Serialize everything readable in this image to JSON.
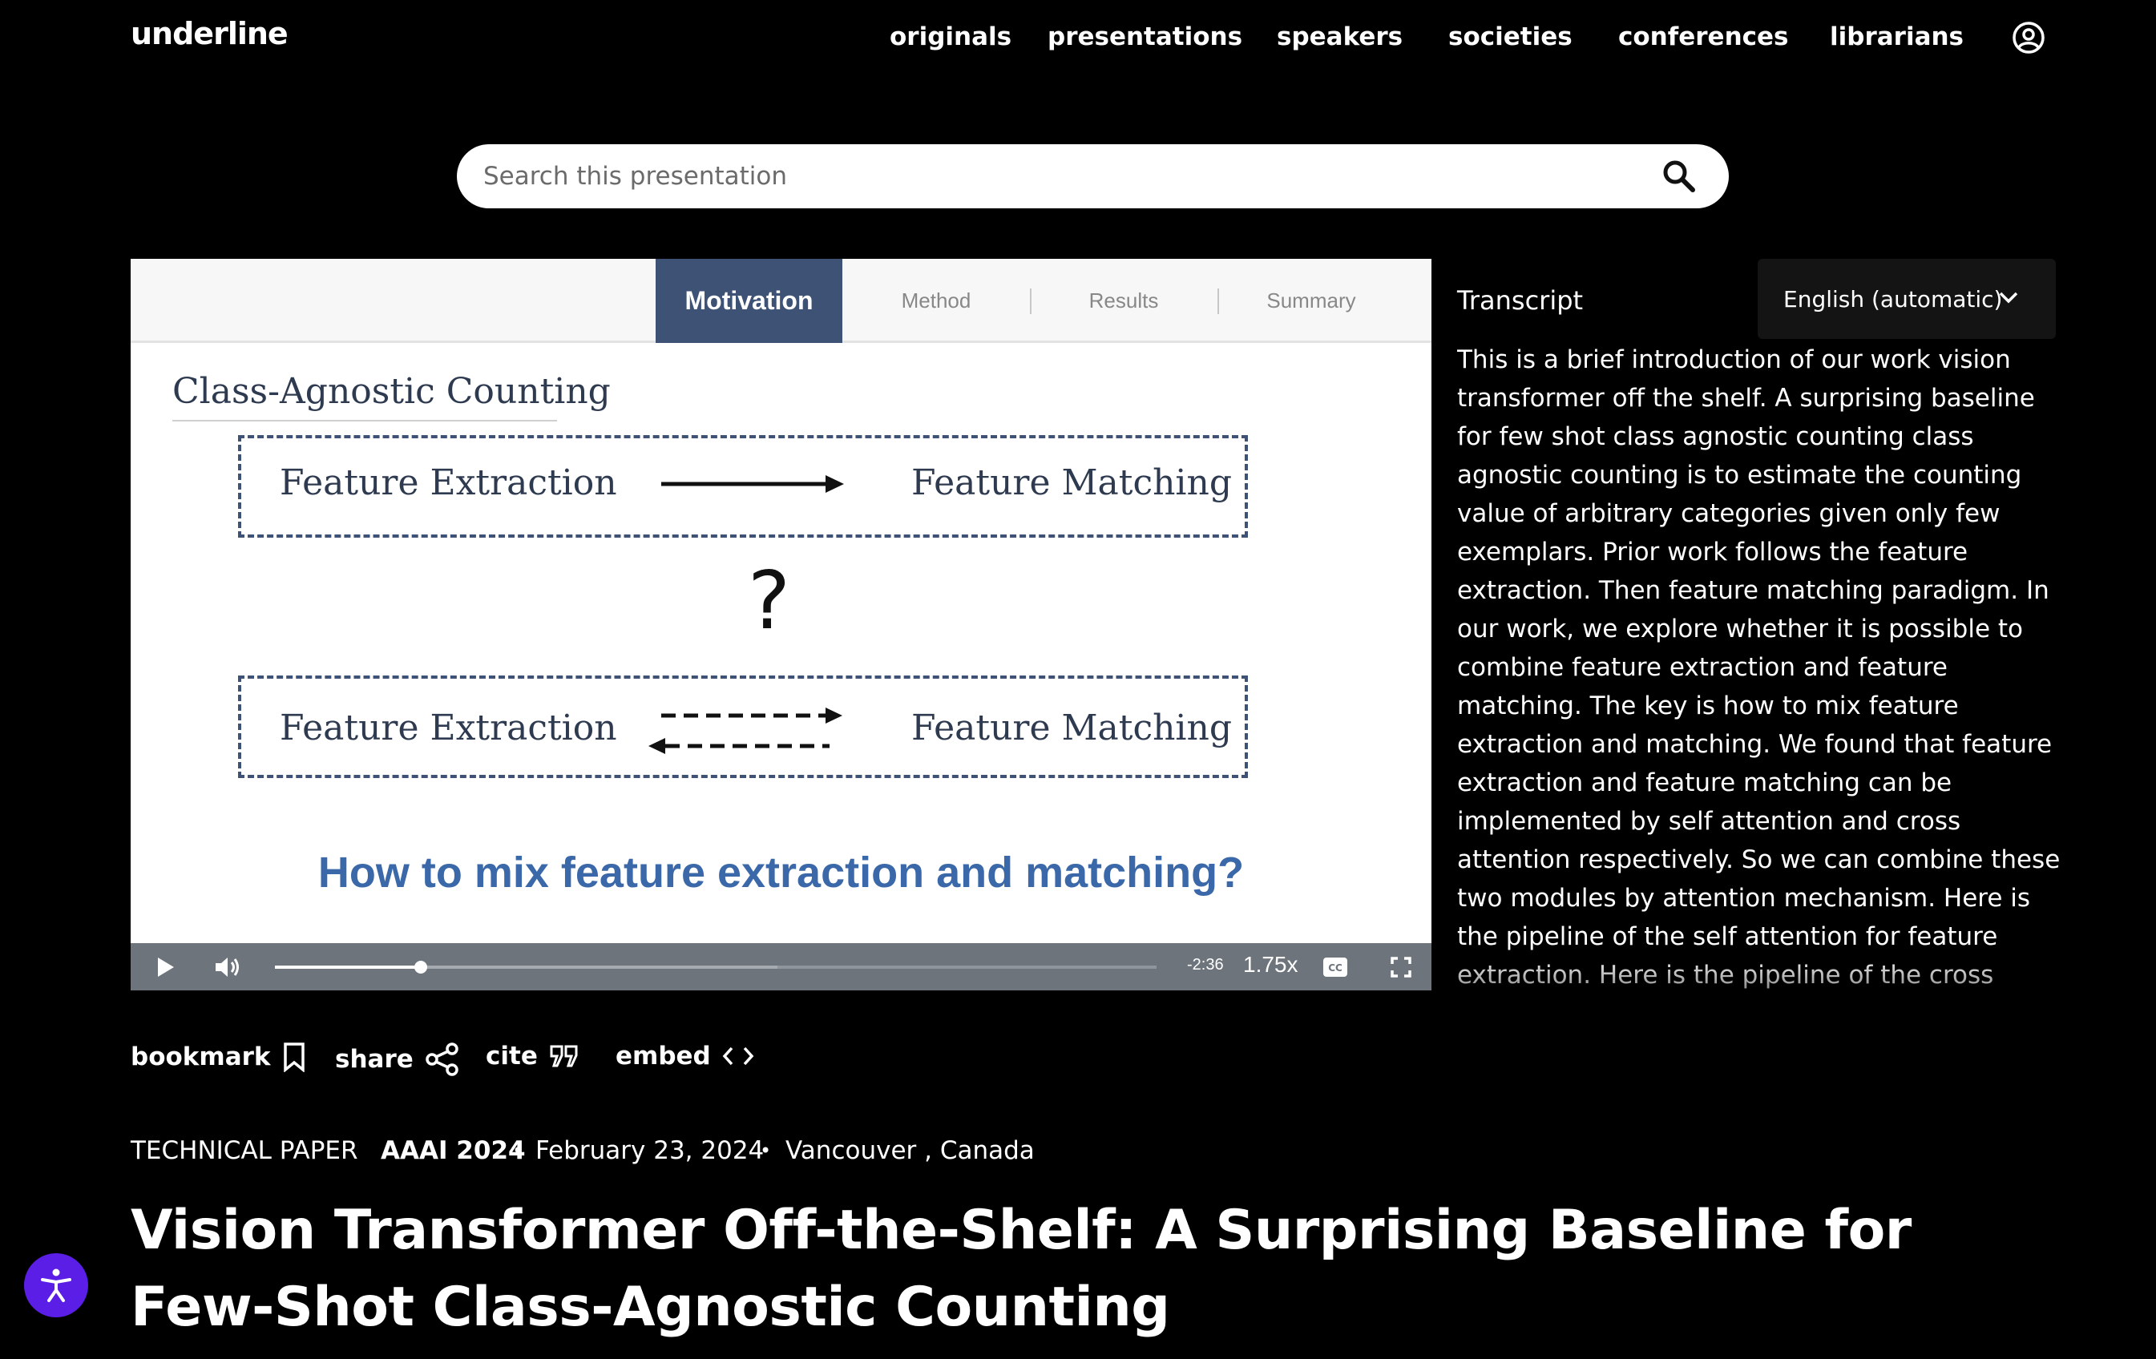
{
  "brand": {
    "logo_text": "underline"
  },
  "nav": {
    "items": [
      "originals",
      "presentations",
      "speakers",
      "societies",
      "conferences",
      "librarians"
    ]
  },
  "search": {
    "placeholder": "Search this presentation"
  },
  "slide": {
    "tabs": [
      "Motivation",
      "Method",
      "Results",
      "Summary"
    ],
    "active_tab": "Motivation",
    "heading": "Class-Agnostic Counting",
    "box1": {
      "left": "Feature Extraction",
      "right": "Feature Matching"
    },
    "question_mark": "?",
    "box2": {
      "left": "Feature Extraction",
      "right": "Feature Matching"
    },
    "question": "How to mix feature extraction and matching?"
  },
  "player": {
    "progress_fraction": 0.165,
    "time_remaining": "-2:36",
    "speed": "1.75x"
  },
  "transcript": {
    "title": "Transcript",
    "language": "English (automatic)",
    "text": "This is a brief introduction of our work vision transformer off the shelf. A surprising baseline for few shot class agnostic counting class agnostic counting is to estimate the counting value of arbitrary categories given only few exemplars. Prior work follows the feature extraction. Then feature matching paradigm. In our work, we explore whether it is possible to combine feature extraction and feature matching. The key is how to mix feature extraction and matching. We found that feature extraction and feature matching can be implemented by self attention and cross attention respectively. So we can combine these two modules by attention mechanism. Here is the pipeline of the self attention for feature extraction. Here is the pipeline of the cross attention for feature matching. By combining the query image with the exemplars,"
  },
  "actions": {
    "bookmark": "bookmark",
    "share": "share",
    "cite": "cite",
    "embed": "embed"
  },
  "meta": {
    "type": "TECHNICAL PAPER",
    "conference": "AAAI 2024",
    "date": "February 23, 2024",
    "location": "Vancouver , Canada",
    "separator": "•"
  },
  "title": "Vision Transformer Off-the-Shelf: A Surprising Baseline for Few-Shot Class-Agnostic Counting",
  "colors": {
    "accent_purple": "#5a1ee6",
    "slide_tab_active": "#3d5275",
    "slide_question": "#3a68a8",
    "player_bar": "#6d747c"
  }
}
